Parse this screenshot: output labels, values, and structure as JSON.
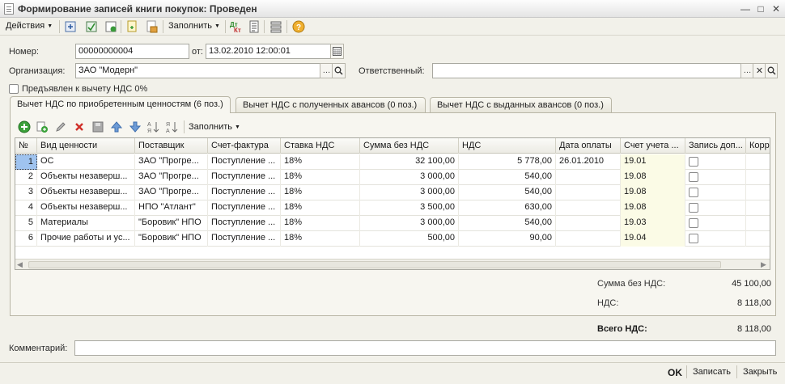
{
  "window": {
    "title": "Формирование записей книги покупок: Проведен"
  },
  "toolbar": {
    "actions_label": "Действия",
    "fill_label": "Заполнить"
  },
  "form": {
    "number_label": "Номер:",
    "number_value": "00000000004",
    "date_label": "от:",
    "date_value": "13.02.2010 12:00:01",
    "org_label": "Организация:",
    "org_value": "ЗАО \"Модерн\"",
    "responsible_label": "Ответственный:",
    "responsible_value": "",
    "vat0_label": "Предъявлен к вычету НДС 0%",
    "comment_label": "Комментарий:",
    "comment_value": ""
  },
  "tabs": [
    {
      "label": "Вычет НДС по приобретенным ценностям (6 поз.)"
    },
    {
      "label": "Вычет НДС с полученных авансов (0 поз.)"
    },
    {
      "label": "Вычет НДС с выданных авансов (0 поз.)"
    }
  ],
  "table_toolbar": {
    "fill_label": "Заполнить"
  },
  "table": {
    "columns": [
      "№",
      "Вид ценности",
      "Поставщик",
      "Счет-фактура",
      "Ставка НДС",
      "Сумма без НДС",
      "НДС",
      "Дата оплаты",
      "Счет учета ...",
      "Запись доп...",
      "Корре"
    ],
    "rows": [
      {
        "n": "1",
        "kind": "ОС",
        "supplier": "ЗАО \"Прогре...",
        "invoice": "Поступление ...",
        "rate": "18%",
        "sum": "32 100,00",
        "vat": "5 778,00",
        "paydate": "26.01.2010",
        "account": "19.01"
      },
      {
        "n": "2",
        "kind": "Объекты незаверш...",
        "supplier": "ЗАО \"Прогре...",
        "invoice": "Поступление ...",
        "rate": "18%",
        "sum": "3 000,00",
        "vat": "540,00",
        "paydate": "",
        "account": "19.08"
      },
      {
        "n": "3",
        "kind": "Объекты незаверш...",
        "supplier": "ЗАО \"Прогре...",
        "invoice": "Поступление ...",
        "rate": "18%",
        "sum": "3 000,00",
        "vat": "540,00",
        "paydate": "",
        "account": "19.08"
      },
      {
        "n": "4",
        "kind": "Объекты незаверш...",
        "supplier": "НПО \"Атлант\"",
        "invoice": "Поступление ...",
        "rate": "18%",
        "sum": "3 500,00",
        "vat": "630,00",
        "paydate": "",
        "account": "19.08"
      },
      {
        "n": "5",
        "kind": "Материалы",
        "supplier": "\"Боровик\" НПО",
        "invoice": "Поступление ...",
        "rate": "18%",
        "sum": "3 000,00",
        "vat": "540,00",
        "paydate": "",
        "account": "19.03"
      },
      {
        "n": "6",
        "kind": "Прочие работы и ус...",
        "supplier": "\"Боровик\" НПО",
        "invoice": "Поступление ...",
        "rate": "18%",
        "sum": "500,00",
        "vat": "90,00",
        "paydate": "",
        "account": "19.04"
      }
    ]
  },
  "totals": {
    "sum_label": "Сумма без НДС:",
    "sum_value": "45 100,00",
    "vat_label": "НДС:",
    "vat_value": "8 118,00",
    "total_label": "Всего НДС:",
    "total_value": "8 118,00"
  },
  "footer": {
    "ok_label": "OK",
    "save_label": "Записать",
    "close_label": "Закрыть"
  }
}
